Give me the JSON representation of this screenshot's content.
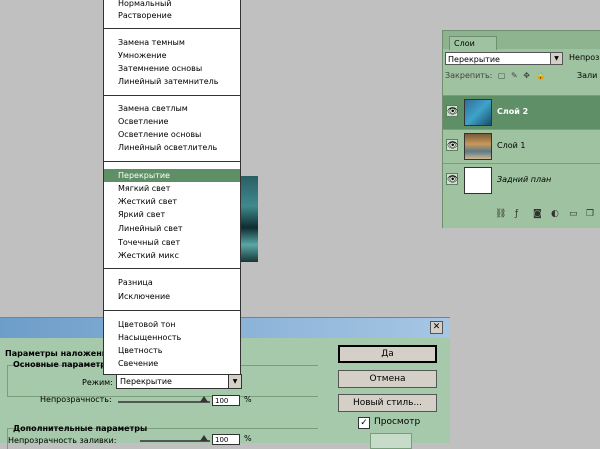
{
  "colors": {
    "panel": "#9fc3a0",
    "selected": "#5e8f66",
    "dialog": "#a5c9aa",
    "titlebar": "#6d9dc9"
  },
  "layers": {
    "tab": "Слои",
    "blend_mode": "Перекрытие",
    "opacity_label": "Непроз",
    "lock_label": "Закрепить:",
    "fill_label": "Зали",
    "items": [
      {
        "name": "Слой 2",
        "selected": true
      },
      {
        "name": "Слой 1",
        "selected": false
      },
      {
        "name": "Задний план",
        "selected": false
      }
    ],
    "footer_icons": [
      "link-icon",
      "fx-icon",
      "mask-icon",
      "adjustment-icon",
      "folder-icon",
      "new-layer-icon"
    ]
  },
  "blend_list": {
    "groups": [
      [
        "Нормальный",
        "Растворение"
      ],
      [
        "Замена темным",
        "Умножение",
        "Затемнение основы",
        "Линейный затемнитель"
      ],
      [
        "Замена светлым",
        "Осветление",
        "Осветление основы",
        "Линейный осветлитель"
      ],
      [
        "Перекрытие",
        "Мягкий свет",
        "Жесткий свет",
        "Яркий свет",
        "Линейный свет",
        "Точечный свет",
        "Жесткий микс"
      ],
      [
        "Разница",
        "Исключение"
      ],
      [
        "Цветовой тон",
        "Насыщенность",
        "Цветность",
        "Свечение"
      ]
    ],
    "selected": "Перекрытие"
  },
  "dialog": {
    "close": "✕",
    "params_heading": "Параметры наложения",
    "basic_group": "Основные параметры",
    "mode_label": "Режим:",
    "mode_value": "Перекрытие",
    "opacity_label": "Непрозрачность:",
    "opacity_value": "100",
    "adv_group": "Дополнительные параметры",
    "fill_opacity_label": "Непрозрачность заливки:",
    "fill_opacity_value": "100",
    "percent": "%",
    "ok": "Да",
    "cancel": "Отмена",
    "new_style": "Новый стиль...",
    "preview_label": "Просмотр",
    "preview_checked": true
  }
}
